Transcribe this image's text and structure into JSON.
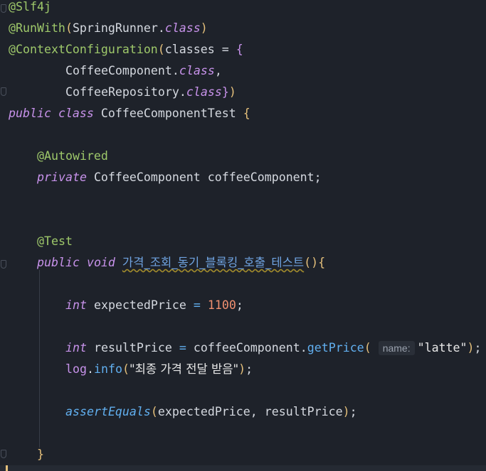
{
  "editor": {
    "lines": {
      "l1": {
        "annot": "@Slf4j"
      },
      "l2": {
        "annot": "@RunWith",
        "p1": "(",
        "cls": "SpringRunner",
        "dot": ".",
        "kw": "class",
        "p2": ")"
      },
      "l3": {
        "annot": "@ContextConfiguration",
        "p1": "(",
        "name": "classes = ",
        "brace": "{"
      },
      "l4": {
        "cls": "CoffeeComponent",
        "dot": ".",
        "kw": "class",
        "comma": ","
      },
      "l5": {
        "cls": "CoffeeRepository",
        "dot": ".",
        "kw": "class",
        "brace": "}",
        "p2": ")"
      },
      "l6": {
        "kw1": "public",
        "kw2": "class",
        "name": "CoffeeComponentTest",
        "brace": "{"
      },
      "l7": {
        "annot": "@Autowired"
      },
      "l8": {
        "kw": "private",
        "type": "CoffeeComponent",
        "name": "coffeeComponent;"
      },
      "l9": {
        "annot": "@Test"
      },
      "l10": {
        "kw1": "public",
        "kw2": "void",
        "method": "가격_조회_동기_블록킹_호출_테스트",
        "parens": "()",
        "brace": "{"
      },
      "l11": {
        "type": "int",
        "name": "expectedPrice",
        "eq": "=",
        "num": "1100",
        "semi": ";"
      },
      "l12": {
        "type": "int",
        "name": "resultPrice",
        "eq": "=",
        "obj": "coffeeComponent",
        "dot": ".",
        "method": "getPrice",
        "p1": "(",
        "hint": "name:",
        "str": "\"latte\"",
        "p2": ")",
        "semi": ";"
      },
      "l13": {
        "obj": "log",
        "dot": ".",
        "method": "info",
        "p1": "(",
        "str": "\"최종 가격 전달 받음\"",
        "p2": ")",
        "semi": ";"
      },
      "l14": {
        "method": "assertEquals",
        "p1": "(",
        "args": "expectedPrice, resultPrice",
        "p2": ")",
        "semi": ";"
      },
      "l15": {
        "brace": "}"
      }
    }
  }
}
